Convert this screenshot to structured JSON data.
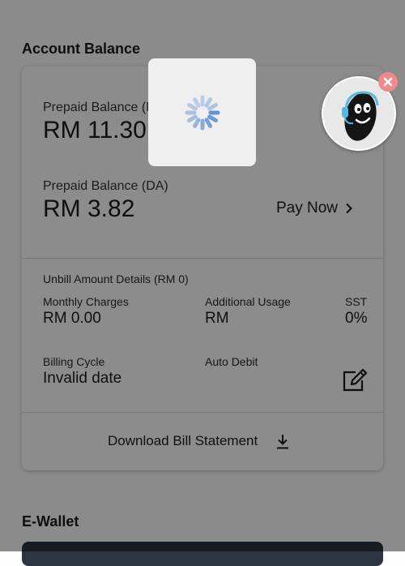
{
  "account_balance": {
    "section_title": "Account Balance",
    "prepaid_ma_label": "Prepaid Balance (MA)",
    "prepaid_ma_value": "RM 11.30",
    "prepaid_da_label": "Prepaid Balance (DA)",
    "prepaid_da_value": "RM 3.82",
    "pay_now_label": "Pay Now",
    "unbill_title": "Unbill Amount Details (RM 0)",
    "monthly_charges_label": "Monthly Charges",
    "monthly_charges_value": "RM 0.00",
    "additional_usage_label": "Additional Usage",
    "additional_usage_value": "RM",
    "sst_label": "SST",
    "sst_value": "0%",
    "billing_cycle_label": "Billing Cycle",
    "billing_cycle_value": "Invalid date",
    "auto_debit_label": "Auto Debit",
    "download_label": "Download Bill Statement"
  },
  "ewallet": {
    "section_title": "E-Wallet"
  },
  "icons": {
    "chevron": "chevron-right-icon",
    "edit": "edit-icon",
    "download": "download-icon",
    "spinner": "loading-spinner-icon",
    "assistant": "chat-assistant-icon",
    "close": "close-icon"
  },
  "colors": {
    "spinner": "#5b8fd1",
    "close_badge": "#f08a8a",
    "ewallet_card": "#2b3440"
  }
}
